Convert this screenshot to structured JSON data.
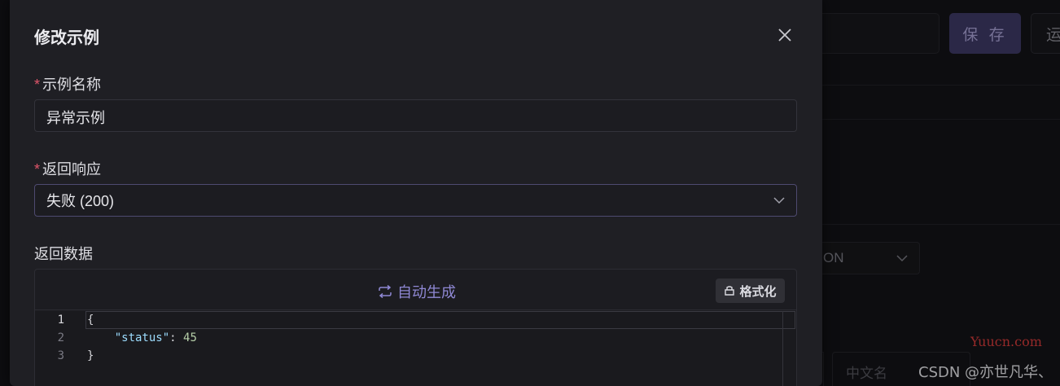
{
  "background": {
    "save_button": "保 存",
    "run_button": "运",
    "select_value": "ON",
    "cn_field_placeholder": "中文名"
  },
  "watermark": {
    "site": "Yuucn.com",
    "csdn": "CSDN @亦世凡华、"
  },
  "modal": {
    "title": "修改示例",
    "fields": {
      "name": {
        "label": "示例名称",
        "required": true,
        "value": "异常示例"
      },
      "response": {
        "label": "返回响应",
        "required": true,
        "value": "失败 (200)"
      },
      "data": {
        "label": "返回数据",
        "autogen_label": "自动生成",
        "format_label": "格式化"
      }
    },
    "code": {
      "line_numbers": [
        "1",
        "2",
        "3"
      ],
      "line1": "{",
      "line2_indent": "    ",
      "line2_key": "\"status\"",
      "line2_sep": ": ",
      "line2_value": "45",
      "line3": "}"
    }
  },
  "colors": {
    "accent": "#8f88d4",
    "required": "#e0556a",
    "save_button_bg": "#3e3a66"
  }
}
